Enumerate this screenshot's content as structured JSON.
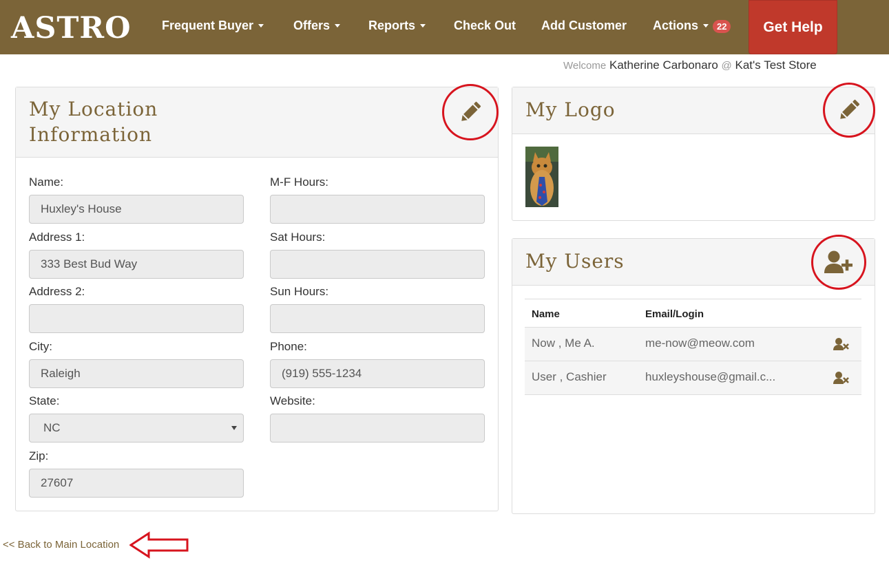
{
  "nav": {
    "brand": "ASTRO",
    "items": [
      {
        "label": "Frequent Buyer",
        "dropdown": true
      },
      {
        "label": "Offers",
        "dropdown": true
      },
      {
        "label": "Reports",
        "dropdown": true
      },
      {
        "label": "Check Out",
        "dropdown": false
      },
      {
        "label": "Add Customer",
        "dropdown": false
      },
      {
        "label": "Actions",
        "dropdown": true
      }
    ],
    "actions_badge": "22",
    "help_label": "Get Help"
  },
  "welcome": {
    "prefix": "Welcome",
    "user": "Katherine Carbonaro",
    "at": "@",
    "store": "Kat's Test Store"
  },
  "location": {
    "title_line1": "My Location",
    "title_line2": "Information",
    "fields": {
      "name": {
        "label": "Name:",
        "value": "Huxley's House"
      },
      "address1": {
        "label": "Address 1:",
        "value": "333 Best Bud Way"
      },
      "address2": {
        "label": "Address 2:",
        "value": ""
      },
      "city": {
        "label": "City:",
        "value": "Raleigh"
      },
      "state": {
        "label": "State:",
        "value": "NC"
      },
      "zip": {
        "label": "Zip:",
        "value": "27607"
      },
      "mf_hours": {
        "label": "M-F Hours:",
        "value": ""
      },
      "sat_hours": {
        "label": "Sat Hours:",
        "value": ""
      },
      "sun_hours": {
        "label": "Sun Hours:",
        "value": ""
      },
      "phone": {
        "label": "Phone:",
        "value": "(919) 555-1234"
      },
      "website": {
        "label": "Website:",
        "value": ""
      }
    }
  },
  "logo": {
    "title": "My Logo"
  },
  "users": {
    "title": "My Users",
    "columns": [
      "Name",
      "Email/Login"
    ],
    "rows": [
      {
        "name": "Now , Me A.",
        "email": "me-now@meow.com"
      },
      {
        "name": "User , Cashier",
        "email": "huxleyshouse@gmail.c..."
      }
    ]
  },
  "footer": {
    "back_link": "<< Back to Main Location"
  },
  "colors": {
    "brand": "#7b6438",
    "help": "#c0392b",
    "highlight": "#d7141e"
  },
  "icons": [
    "pencil-icon",
    "add-user-icon",
    "remove-user-icon",
    "left-arrow-icon"
  ]
}
